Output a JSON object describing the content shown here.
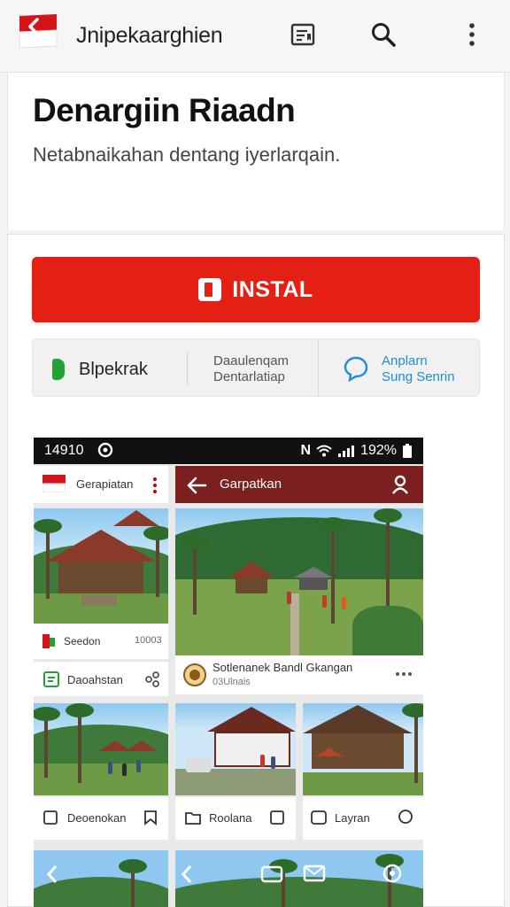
{
  "appbar": {
    "title": "Jnipekaarghien"
  },
  "header": {
    "app_name": "Denargiin Riaadn",
    "description": "Netabnaikahan dentang iyerlarqain."
  },
  "install": {
    "label": "INSTAL"
  },
  "info_strip": {
    "left_label": "Blpekrak",
    "mid_line1": "Daaulenqam",
    "mid_line2": "Dentarlatiap",
    "right_line1": "Anplarn",
    "right_line2": "Sung Senrin"
  },
  "phone": {
    "status_time": "14910",
    "status_battery": "192%",
    "left_pane_title": "Gerapiatan",
    "right_pane_title": "Garpatkan",
    "card1_caption": "Seedon",
    "card1_num": "10003",
    "card1_action": "Daoahstan",
    "card2_caption": "Sotlenanek Bandl Gkangan",
    "card2_sub": "03Ulnais",
    "card3_caption": "Deoenokan",
    "card4_caption": "Roolana",
    "card5_caption": "Layran"
  },
  "colors": {
    "accent_red": "#e41f14",
    "dark_red_header": "#7c1f1f",
    "green": "#1fa335",
    "link_blue": "#1a8fd8"
  }
}
